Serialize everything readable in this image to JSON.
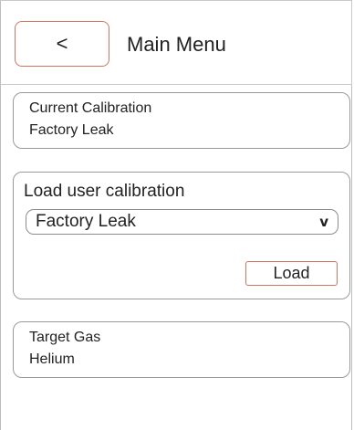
{
  "header": {
    "back_label": "<",
    "title": "Main Menu"
  },
  "current_calibration": {
    "label": "Current Calibration",
    "value": "Factory Leak"
  },
  "user_calibration": {
    "label": "Load user calibration",
    "selected": "Factory Leak",
    "chevron": "v",
    "load_label": "Load"
  },
  "target_gas": {
    "label": "Target Gas",
    "value": "Helium"
  },
  "colors": {
    "accent_border": "#d6735e",
    "card_border": "#9a9a9a"
  }
}
